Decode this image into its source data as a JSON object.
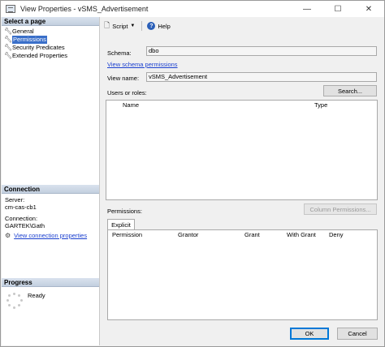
{
  "window": {
    "title": "View Properties - vSMS_Advertisement",
    "controls": {
      "minimize": "—",
      "maximize": "☐",
      "close": "✕"
    }
  },
  "left_pane": {
    "select_page": {
      "header": "Select a page",
      "items": [
        {
          "label": "General",
          "icon": "wrench-icon",
          "selected": false
        },
        {
          "label": "Permissions",
          "icon": "wrench-icon",
          "selected": true
        },
        {
          "label": "Security Predicates",
          "icon": "wrench-icon",
          "selected": false
        },
        {
          "label": "Extended Properties",
          "icon": "wrench-icon",
          "selected": false
        }
      ]
    },
    "connection": {
      "header": "Connection",
      "server_label": "Server:",
      "server_value": "cm-cas-cb1",
      "connection_label": "Connection:",
      "connection_value": "GARTEK\\Gath",
      "view_link": "View connection properties"
    },
    "progress": {
      "header": "Progress",
      "status": "Ready"
    }
  },
  "toolbar": {
    "script_label": "Script",
    "help_label": "Help"
  },
  "form": {
    "schema_label": "Schema:",
    "schema_value": "dbo",
    "schema_permissions_link": "View schema permissions",
    "view_name_label": "View name:",
    "view_name_value": "vSMS_Advertisement",
    "users_roles_label": "Users or roles:",
    "search_button": "Search...",
    "users_columns": [
      "Name",
      "Type"
    ],
    "permissions_label": "Permissions:",
    "column_permissions_button": "Column Permissions...",
    "tab_explicit": "Explicit",
    "permissions_columns": [
      "Permission",
      "Grantor",
      "Grant",
      "With Grant",
      "Deny"
    ]
  },
  "buttons": {
    "ok": "OK",
    "cancel": "Cancel"
  },
  "colors": {
    "selection": "#3a6fc9",
    "link": "#1a3fcf",
    "section_header": "#c3cfdf"
  }
}
